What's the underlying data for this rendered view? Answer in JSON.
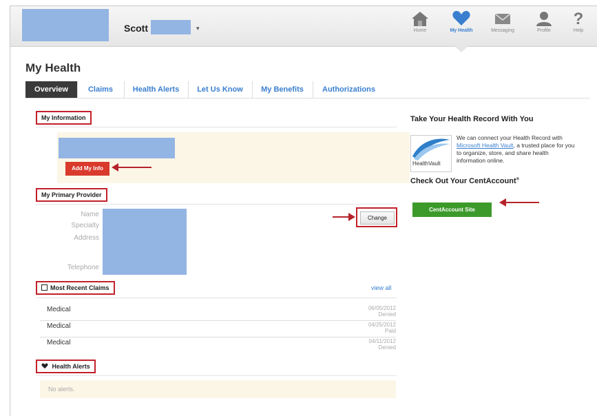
{
  "header": {
    "user_first_name": "Scott",
    "user_caret": "▾",
    "nav": [
      {
        "label": "Home",
        "icon": "home-icon"
      },
      {
        "label": "My Health",
        "icon": "heart-icon"
      },
      {
        "label": "Messaging",
        "icon": "envelope-icon"
      },
      {
        "label": "Profile",
        "icon": "person-icon"
      },
      {
        "label": "Help",
        "icon": "question-icon"
      }
    ],
    "active_nav": "My Health",
    "accent_color": "#3a7fcf"
  },
  "page_title": "My Health",
  "tabs": [
    {
      "label": "Overview"
    },
    {
      "label": "Claims"
    },
    {
      "label": "Health Alerts"
    },
    {
      "label": "Let Us Know"
    },
    {
      "label": "My Benefits"
    },
    {
      "label": "Authorizations"
    }
  ],
  "active_tab": "Overview",
  "my_information": {
    "heading": "My Information",
    "add_button": "Add My Info"
  },
  "primary_provider": {
    "heading": "My Primary Provider",
    "labels": {
      "name": "Name",
      "specialty": "Specialty",
      "address": "Address",
      "telephone": "Telephone"
    },
    "change_button": "Change"
  },
  "recent_claims": {
    "heading": "Most Recent Claims",
    "view_all": "view all",
    "rows": [
      {
        "type": "Medical",
        "date": "06/05/2012",
        "status": "Denied"
      },
      {
        "type": "Medical",
        "date": "04/25/2012",
        "status": "Paid"
      },
      {
        "type": "Medical",
        "date": "04/11/2012",
        "status": "Denied"
      }
    ]
  },
  "health_alerts": {
    "heading": "Health Alerts",
    "empty_text": "No alerts."
  },
  "sidebar": {
    "record_title": "Take Your Health Record With You",
    "record_text_before": "We can connect your Health Record with ",
    "record_link": "Microsoft Health Vault",
    "record_text_after": ", a trusted place for you to organize, store, and share health information online.",
    "healthvault_logo_text": "HealthVault",
    "cent_title": "Check Out Your CentAccount",
    "cent_reg": "®",
    "cent_button": "CentAccount Site",
    "button_color": "#3c9a2b"
  },
  "highlight_color": "#c2202a"
}
